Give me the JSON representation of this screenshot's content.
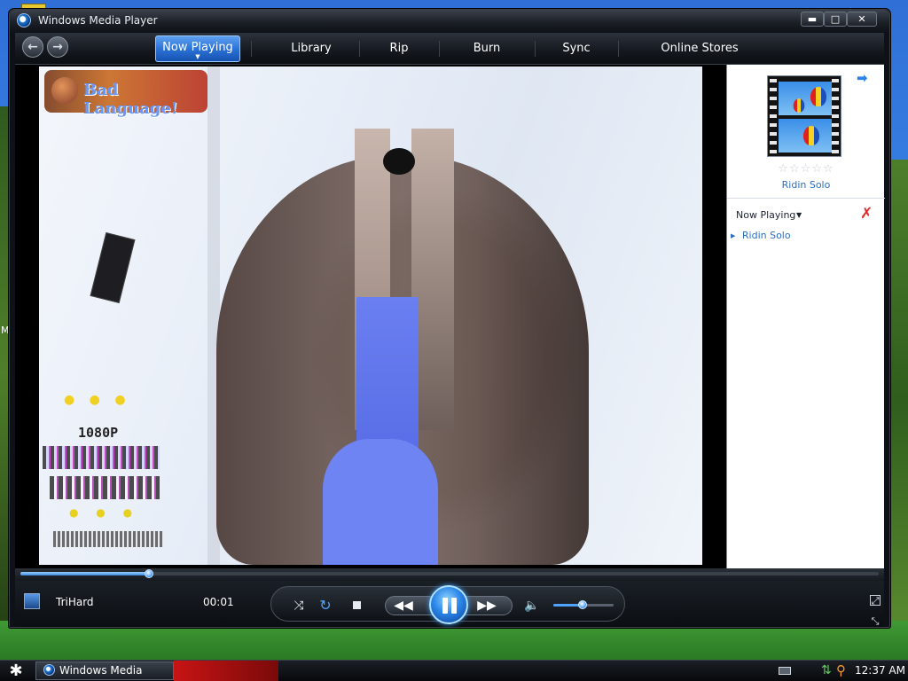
{
  "window": {
    "title": "Windows Media Player",
    "minimize_glyph": "▬",
    "maximize_glyph": "□",
    "close_glyph": "✕"
  },
  "nav": {
    "back_glyph": "←",
    "forward_glyph": "→",
    "tabs": [
      {
        "label": "Now Playing",
        "active": true
      },
      {
        "label": "Library"
      },
      {
        "label": "Rip"
      },
      {
        "label": "Burn"
      },
      {
        "label": "Sync"
      },
      {
        "label": "Online Stores"
      }
    ]
  },
  "video": {
    "watermark_tl": "Bad Language!",
    "overlay_1080": "1080P"
  },
  "side_panel": {
    "arrow_glyph": "➡",
    "rating_glyph": "☆☆☆☆☆",
    "album_title": "Ridin Solo",
    "now_playing_label": "Now Playing",
    "dropdown_glyph": "▼",
    "clear_glyph": "✗",
    "playlist": [
      "Ridin Solo"
    ]
  },
  "playback": {
    "track_name": "TriHard",
    "elapsed": "00:01",
    "seek_fraction": 0.15,
    "volume_fraction": 0.48,
    "shuffle_glyph": "⤨",
    "repeat_glyph": "↻",
    "prev_glyph": "◀◀",
    "next_glyph": "▶▶",
    "volume_glyph": "🔈",
    "fullscreen_glyph": "⤢",
    "compact_glyph": "⤡"
  },
  "taskbar": {
    "start_glyph": "✱",
    "task_label": "Windows Media Player",
    "clock": "12:37 AM",
    "network_glyph": "⇅",
    "search_glyph": "⚲"
  },
  "colors": {
    "accent_blue": "#2b73d8",
    "side_link": "#2a6fc2",
    "clear_red": "#e02a2a"
  },
  "icons": [
    "app-icon",
    "back-icon",
    "forward-icon",
    "album-art-icon",
    "arrow-right-icon",
    "rating-star-icon",
    "clear-list-icon",
    "shuffle-icon",
    "repeat-icon",
    "stop-icon",
    "previous-icon",
    "pause-icon",
    "next-icon",
    "volume-icon",
    "fullscreen-icon",
    "compact-mode-icon",
    "start-icon",
    "keyboard-icon",
    "network-icon",
    "search-icon"
  ]
}
